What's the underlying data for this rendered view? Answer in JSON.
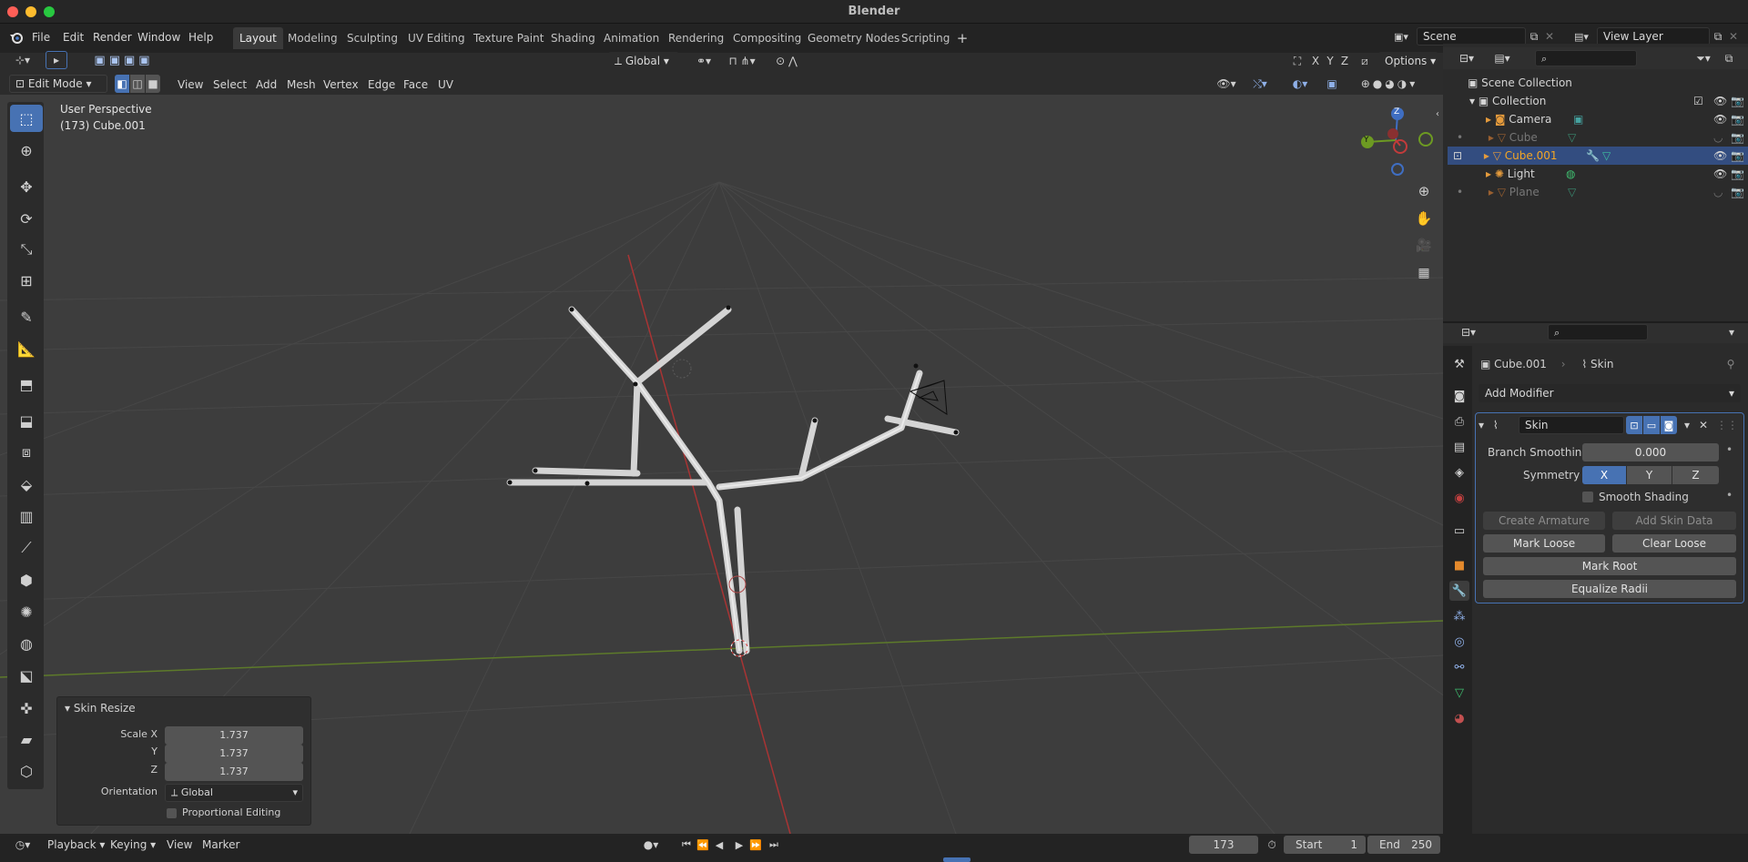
{
  "window": {
    "title": "Blender"
  },
  "menu": [
    "File",
    "Edit",
    "Render",
    "Window",
    "Help"
  ],
  "workspaces": [
    "Layout",
    "Modeling",
    "Sculpting",
    "UV Editing",
    "Texture Paint",
    "Shading",
    "Animation",
    "Rendering",
    "Compositing",
    "Geometry Nodes",
    "Scripting"
  ],
  "active_workspace": "Layout",
  "scene": {
    "name": "Scene",
    "view_layer": "View Layer"
  },
  "viewport_header": {
    "mode": "Edit Mode",
    "menus": [
      "View",
      "Select",
      "Add",
      "Mesh",
      "Vertex",
      "Edge",
      "Face",
      "UV"
    ],
    "orientation": "Global",
    "options": "Options",
    "axes": [
      "X",
      "Y",
      "Z"
    ]
  },
  "viewport": {
    "perspective": "User Perspective",
    "object_info": "(173) Cube.001"
  },
  "gizmo": {
    "z": "Z",
    "y": "Y"
  },
  "operator_panel": {
    "title": "Skin Resize",
    "scale_x_label": "Scale X",
    "scale_x": "1.737",
    "scale_y_label": "Y",
    "scale_y": "1.737",
    "scale_z_label": "Z",
    "scale_z": "1.737",
    "orientation_label": "Orientation",
    "orientation": "Global",
    "proportional": "Proportional Editing"
  },
  "outliner": {
    "root": "Scene Collection",
    "collection": "Collection",
    "items": [
      {
        "name": "Camera",
        "dim": false,
        "selected": false
      },
      {
        "name": "Cube",
        "dim": true,
        "selected": false
      },
      {
        "name": "Cube.001",
        "dim": false,
        "selected": true
      },
      {
        "name": "Light",
        "dim": false,
        "selected": false
      },
      {
        "name": "Plane",
        "dim": true,
        "selected": false
      }
    ]
  },
  "properties": {
    "object": "Cube.001",
    "modifier_context": "Skin",
    "add_modifier": "Add Modifier",
    "modifier_name": "Skin",
    "branch_smoothing_label": "Branch Smoothing",
    "branch_smoothing": "0.000",
    "symmetry_label": "Symmetry",
    "symmetry": [
      "X",
      "Y",
      "Z"
    ],
    "smooth_shading": "Smooth Shading",
    "create_armature": "Create Armature",
    "add_skin_data": "Add Skin Data",
    "mark_loose": "Mark Loose",
    "clear_loose": "Clear Loose",
    "mark_root": "Mark Root",
    "equalize_radii": "Equalize Radii"
  },
  "timeline": {
    "playback": "Playback",
    "keying": "Keying",
    "view": "View",
    "marker": "Marker",
    "current_frame": "173",
    "start_label": "Start",
    "start": "1",
    "end_label": "End",
    "end": "250"
  },
  "colors": {
    "accent": "#4772b3",
    "selected_text": "#f5a623",
    "x_axis": "#c23b3b",
    "y_axis": "#6d9a22",
    "z_axis": "#3f6ec2"
  }
}
